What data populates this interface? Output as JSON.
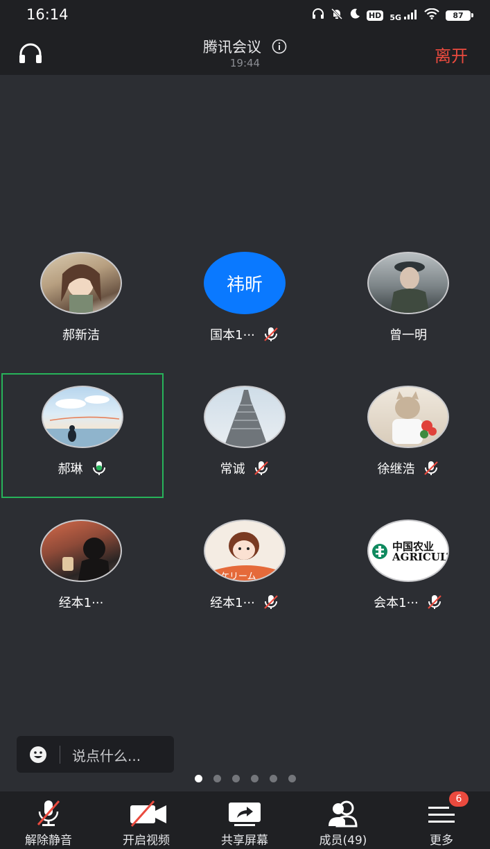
{
  "status_bar": {
    "time": "16:14",
    "hd_label": "HD",
    "network_label": "5G",
    "battery": "87"
  },
  "header": {
    "title": "腾讯会议",
    "timer": "19:44",
    "leave_label": "离开"
  },
  "participants": [
    {
      "name": "郝新洁",
      "avatar_text": "",
      "mic": "none",
      "speaking": false
    },
    {
      "name": "国本1···",
      "avatar_text": "祎昕",
      "mic": "muted",
      "speaking": false
    },
    {
      "name": "曾一明",
      "avatar_text": "",
      "mic": "none",
      "speaking": false
    },
    {
      "name": "郝琳",
      "avatar_text": "",
      "mic": "active",
      "speaking": true
    },
    {
      "name": "常诚",
      "avatar_text": "",
      "mic": "muted",
      "speaking": false
    },
    {
      "name": "徐继浩",
      "avatar_text": "",
      "mic": "muted",
      "speaking": false
    },
    {
      "name": "经本1···",
      "avatar_text": "",
      "mic": "none",
      "speaking": false
    },
    {
      "name": "经本1···",
      "avatar_text": "",
      "mic": "muted",
      "speaking": false
    },
    {
      "name": "会本1···",
      "avatar_text": "中国农业\nAGRICULTURAL BA",
      "mic": "muted",
      "speaking": false
    }
  ],
  "chat": {
    "placeholder": "说点什么..."
  },
  "pager": {
    "count": 6,
    "active": 0
  },
  "toolbar": {
    "unmute_label": "解除静音",
    "video_label": "开启视频",
    "share_label": "共享屏幕",
    "members_label": "成员(49)",
    "more_label": "更多",
    "more_badge": "6"
  },
  "colors": {
    "background": "#2c2e33",
    "bar": "#1f2023",
    "accent_blue": "#0a79ff",
    "leave_red": "#ea4a3e",
    "speaking_green": "#27b35a"
  }
}
